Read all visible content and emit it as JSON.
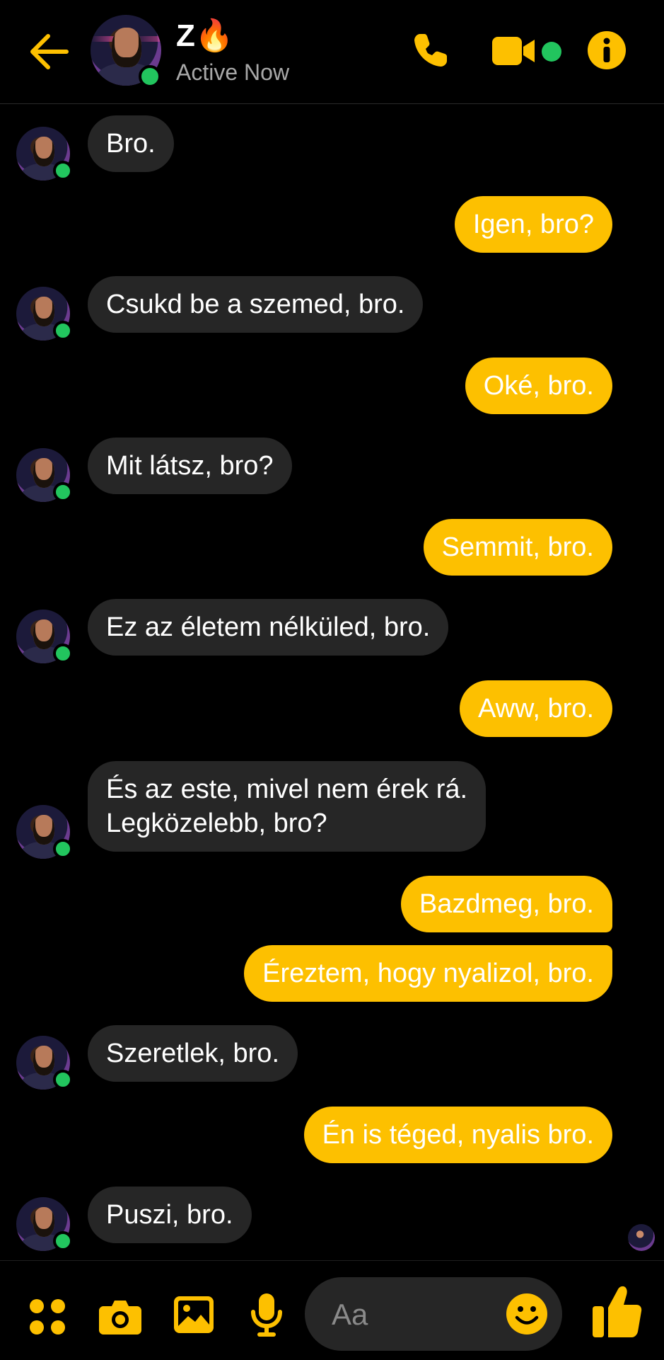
{
  "colors": {
    "accent": "#fdc000",
    "incoming_bubble": "#262626",
    "online": "#22c55e",
    "background": "#000000"
  },
  "header": {
    "contact_name": "Z🔥",
    "status": "Active Now",
    "icons": [
      "back-arrow-icon",
      "phone-icon",
      "video-camera-icon",
      "info-icon"
    ]
  },
  "messages": [
    {
      "dir": "in",
      "text": "Bro."
    },
    {
      "dir": "out",
      "text": "Igen, bro?"
    },
    {
      "dir": "in",
      "text": "Csukd be a szemed, bro."
    },
    {
      "dir": "out",
      "text": "Oké, bro."
    },
    {
      "dir": "in",
      "text": "Mit látsz, bro?"
    },
    {
      "dir": "out",
      "text": "Semmit, bro."
    },
    {
      "dir": "in",
      "text": "Ez az életem nélküled, bro."
    },
    {
      "dir": "out",
      "text": "Aww, bro."
    },
    {
      "dir": "in",
      "text": "És az este, mivel nem érek rá.",
      "text2": "Legközelebb, bro?"
    },
    {
      "dir": "out",
      "text": "Bazdmeg, bro."
    },
    {
      "dir": "out",
      "text": "Éreztem, hogy nyalizol, bro."
    },
    {
      "dir": "in",
      "text": "Szeretlek, bro."
    },
    {
      "dir": "out",
      "text": "Én is téged, nyalis bro."
    },
    {
      "dir": "in",
      "text": "Puszi, bro."
    }
  ],
  "composer": {
    "placeholder": "Aa",
    "value": "",
    "icons": [
      "apps-icon",
      "camera-icon",
      "gallery-icon",
      "microphone-icon",
      "emoji-icon",
      "thumbs-up-icon"
    ]
  }
}
